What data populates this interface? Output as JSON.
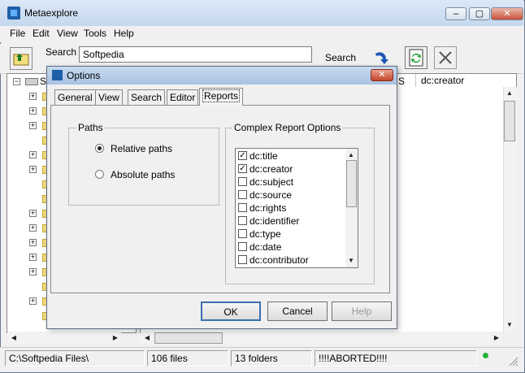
{
  "app": {
    "title": "Metaexplore",
    "minimize": "‒",
    "maximize": "▢",
    "close": "✕"
  },
  "menu": [
    "File",
    "Edit",
    "View",
    "Tools",
    "Help"
  ],
  "toolbar": {
    "search_label": "Search",
    "search_value": "Softpedia",
    "search_button": "Search"
  },
  "list": {
    "columns": [
      "S",
      "dc:creator"
    ]
  },
  "tree": {
    "root_label": "S"
  },
  "status": {
    "path": "C:\\Softpedia Files\\",
    "files": "106 files",
    "folders": "13 folders",
    "message": "!!!!ABORTED!!!!"
  },
  "dialog": {
    "title": "Options",
    "close": "✕",
    "tabs": [
      "General",
      "View",
      "Search",
      "Editor",
      "Reports"
    ],
    "active_tab": "Reports",
    "paths": {
      "label": "Paths",
      "options": [
        {
          "label": "Relative paths",
          "selected": true
        },
        {
          "label": "Absolute paths",
          "selected": false
        }
      ]
    },
    "report": {
      "label": "Complex Report Options",
      "items": [
        {
          "label": "dc:title",
          "checked": true
        },
        {
          "label": "dc:creator",
          "checked": true
        },
        {
          "label": "dc:subject",
          "checked": false
        },
        {
          "label": "dc:source",
          "checked": false
        },
        {
          "label": "dc:rights",
          "checked": false
        },
        {
          "label": "dc:identifier",
          "checked": false
        },
        {
          "label": "dc:type",
          "checked": false
        },
        {
          "label": "dc:date",
          "checked": false
        },
        {
          "label": "dc:contributor",
          "checked": false
        }
      ]
    },
    "buttons": {
      "ok": "OK",
      "cancel": "Cancel",
      "help": "Help"
    }
  },
  "icons": [
    "folder-up-icon",
    "refresh-icon",
    "sync-icon",
    "close-x-icon",
    "status-led-icon",
    "size-grip-icon"
  ]
}
